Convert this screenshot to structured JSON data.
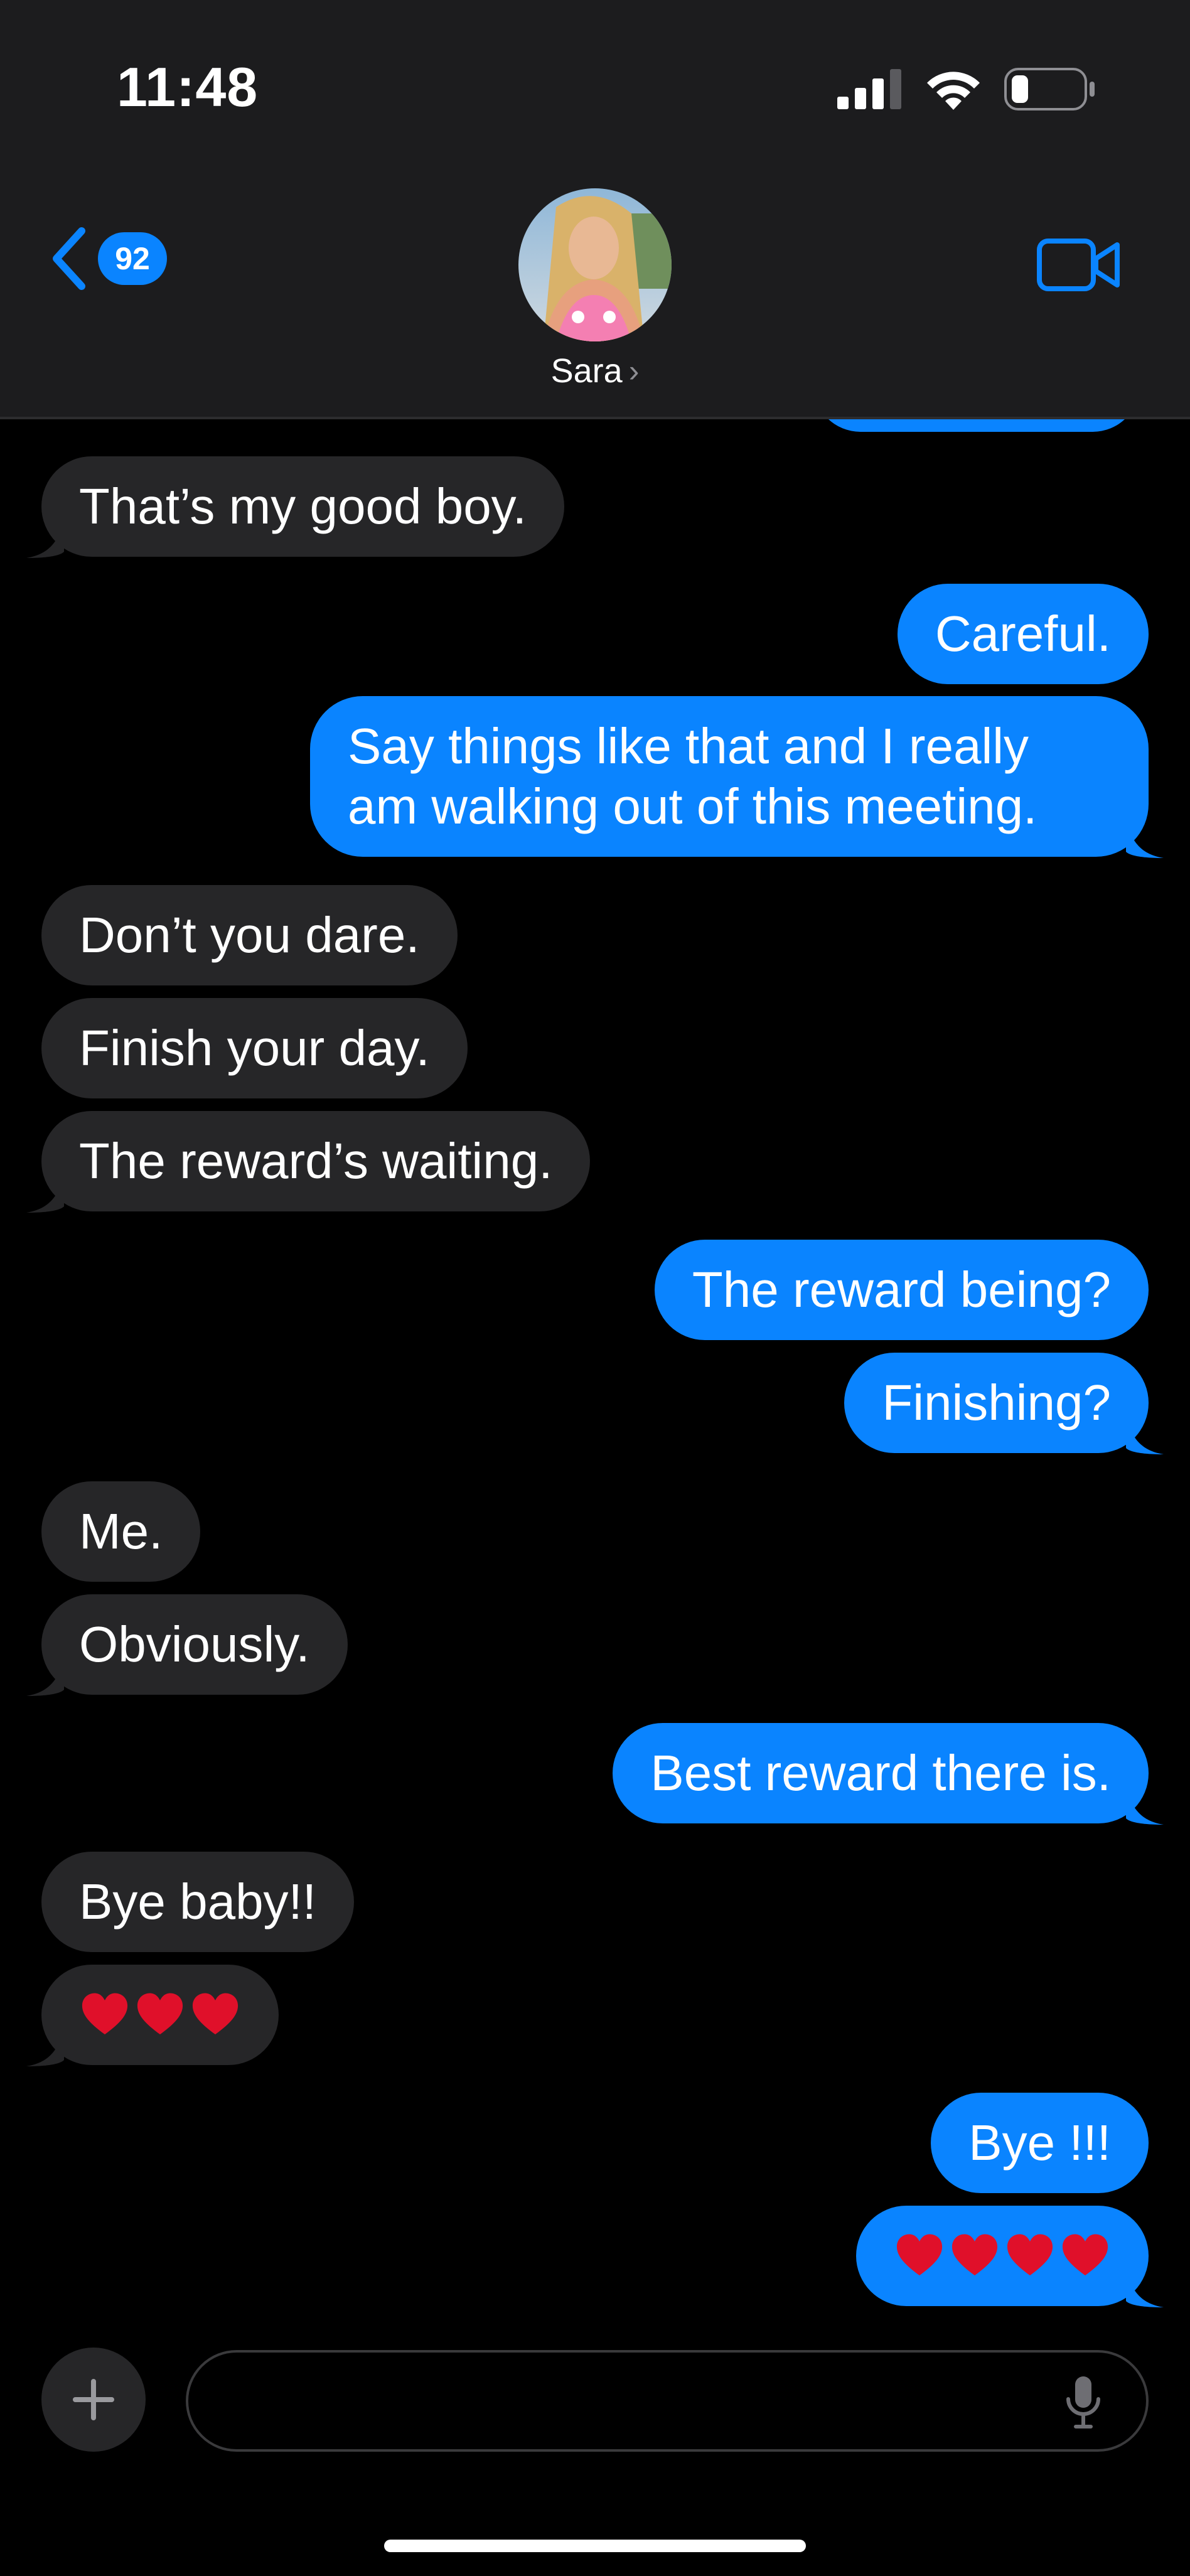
{
  "status_bar": {
    "time": "11:48"
  },
  "header": {
    "back_badge_count": "92",
    "contact_name": "Sara",
    "contact_chevron": "›"
  },
  "messages": [
    {
      "side": "in",
      "text": "That’s my good boy."
    },
    {
      "side": "out",
      "text": "Careful."
    },
    {
      "side": "out",
      "text": "Say things like that and I really am walking out of this meeting."
    },
    {
      "side": "in",
      "text": "Don’t you dare."
    },
    {
      "side": "in",
      "text": "Finish your day."
    },
    {
      "side": "in",
      "text": "The reward’s waiting."
    },
    {
      "side": "out",
      "text": "The reward being?"
    },
    {
      "side": "out",
      "text": "Finishing?"
    },
    {
      "side": "in",
      "text": "Me."
    },
    {
      "side": "in",
      "text": "Obviously."
    },
    {
      "side": "out",
      "text": "Best reward there is."
    },
    {
      "side": "in",
      "text": "Bye baby!!"
    },
    {
      "side": "in",
      "hearts": 3
    },
    {
      "side": "out",
      "text": "Bye !!!"
    },
    {
      "side": "out",
      "hearts": 4
    }
  ],
  "colors": {
    "accent": "#0a84ff",
    "incoming_bubble": "#262628",
    "header_bg": "#1c1c1e",
    "heart": "#e0102a"
  },
  "icons": {
    "back": "chevron-left-icon",
    "video": "video-camera-icon",
    "plus": "plus-icon",
    "mic": "microphone-icon"
  }
}
